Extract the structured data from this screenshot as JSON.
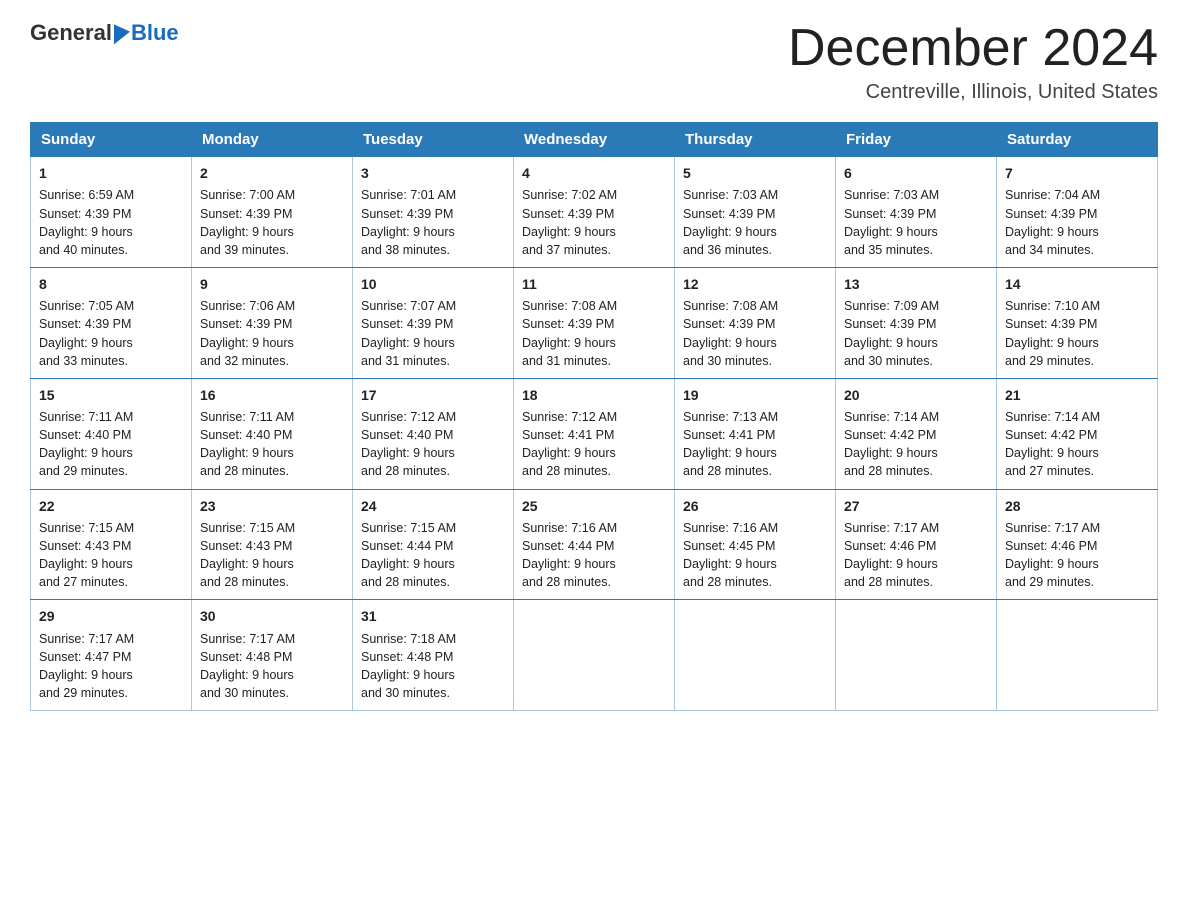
{
  "logo": {
    "general": "General",
    "blue": "Blue"
  },
  "title": {
    "month": "December 2024",
    "location": "Centreville, Illinois, United States"
  },
  "days_of_week": [
    "Sunday",
    "Monday",
    "Tuesday",
    "Wednesday",
    "Thursday",
    "Friday",
    "Saturday"
  ],
  "weeks": [
    [
      {
        "day": "1",
        "sunrise": "6:59 AM",
        "sunset": "4:39 PM",
        "daylight": "9 hours and 40 minutes."
      },
      {
        "day": "2",
        "sunrise": "7:00 AM",
        "sunset": "4:39 PM",
        "daylight": "9 hours and 39 minutes."
      },
      {
        "day": "3",
        "sunrise": "7:01 AM",
        "sunset": "4:39 PM",
        "daylight": "9 hours and 38 minutes."
      },
      {
        "day": "4",
        "sunrise": "7:02 AM",
        "sunset": "4:39 PM",
        "daylight": "9 hours and 37 minutes."
      },
      {
        "day": "5",
        "sunrise": "7:03 AM",
        "sunset": "4:39 PM",
        "daylight": "9 hours and 36 minutes."
      },
      {
        "day": "6",
        "sunrise": "7:03 AM",
        "sunset": "4:39 PM",
        "daylight": "9 hours and 35 minutes."
      },
      {
        "day": "7",
        "sunrise": "7:04 AM",
        "sunset": "4:39 PM",
        "daylight": "9 hours and 34 minutes."
      }
    ],
    [
      {
        "day": "8",
        "sunrise": "7:05 AM",
        "sunset": "4:39 PM",
        "daylight": "9 hours and 33 minutes."
      },
      {
        "day": "9",
        "sunrise": "7:06 AM",
        "sunset": "4:39 PM",
        "daylight": "9 hours and 32 minutes."
      },
      {
        "day": "10",
        "sunrise": "7:07 AM",
        "sunset": "4:39 PM",
        "daylight": "9 hours and 31 minutes."
      },
      {
        "day": "11",
        "sunrise": "7:08 AM",
        "sunset": "4:39 PM",
        "daylight": "9 hours and 31 minutes."
      },
      {
        "day": "12",
        "sunrise": "7:08 AM",
        "sunset": "4:39 PM",
        "daylight": "9 hours and 30 minutes."
      },
      {
        "day": "13",
        "sunrise": "7:09 AM",
        "sunset": "4:39 PM",
        "daylight": "9 hours and 30 minutes."
      },
      {
        "day": "14",
        "sunrise": "7:10 AM",
        "sunset": "4:39 PM",
        "daylight": "9 hours and 29 minutes."
      }
    ],
    [
      {
        "day": "15",
        "sunrise": "7:11 AM",
        "sunset": "4:40 PM",
        "daylight": "9 hours and 29 minutes."
      },
      {
        "day": "16",
        "sunrise": "7:11 AM",
        "sunset": "4:40 PM",
        "daylight": "9 hours and 28 minutes."
      },
      {
        "day": "17",
        "sunrise": "7:12 AM",
        "sunset": "4:40 PM",
        "daylight": "9 hours and 28 minutes."
      },
      {
        "day": "18",
        "sunrise": "7:12 AM",
        "sunset": "4:41 PM",
        "daylight": "9 hours and 28 minutes."
      },
      {
        "day": "19",
        "sunrise": "7:13 AM",
        "sunset": "4:41 PM",
        "daylight": "9 hours and 28 minutes."
      },
      {
        "day": "20",
        "sunrise": "7:14 AM",
        "sunset": "4:42 PM",
        "daylight": "9 hours and 28 minutes."
      },
      {
        "day": "21",
        "sunrise": "7:14 AM",
        "sunset": "4:42 PM",
        "daylight": "9 hours and 27 minutes."
      }
    ],
    [
      {
        "day": "22",
        "sunrise": "7:15 AM",
        "sunset": "4:43 PM",
        "daylight": "9 hours and 27 minutes."
      },
      {
        "day": "23",
        "sunrise": "7:15 AM",
        "sunset": "4:43 PM",
        "daylight": "9 hours and 28 minutes."
      },
      {
        "day": "24",
        "sunrise": "7:15 AM",
        "sunset": "4:44 PM",
        "daylight": "9 hours and 28 minutes."
      },
      {
        "day": "25",
        "sunrise": "7:16 AM",
        "sunset": "4:44 PM",
        "daylight": "9 hours and 28 minutes."
      },
      {
        "day": "26",
        "sunrise": "7:16 AM",
        "sunset": "4:45 PM",
        "daylight": "9 hours and 28 minutes."
      },
      {
        "day": "27",
        "sunrise": "7:17 AM",
        "sunset": "4:46 PM",
        "daylight": "9 hours and 28 minutes."
      },
      {
        "day": "28",
        "sunrise": "7:17 AM",
        "sunset": "4:46 PM",
        "daylight": "9 hours and 29 minutes."
      }
    ],
    [
      {
        "day": "29",
        "sunrise": "7:17 AM",
        "sunset": "4:47 PM",
        "daylight": "9 hours and 29 minutes."
      },
      {
        "day": "30",
        "sunrise": "7:17 AM",
        "sunset": "4:48 PM",
        "daylight": "9 hours and 30 minutes."
      },
      {
        "day": "31",
        "sunrise": "7:18 AM",
        "sunset": "4:48 PM",
        "daylight": "9 hours and 30 minutes."
      },
      null,
      null,
      null,
      null
    ]
  ],
  "labels": {
    "sunrise": "Sunrise:",
    "sunset": "Sunset:",
    "daylight": "Daylight:"
  }
}
